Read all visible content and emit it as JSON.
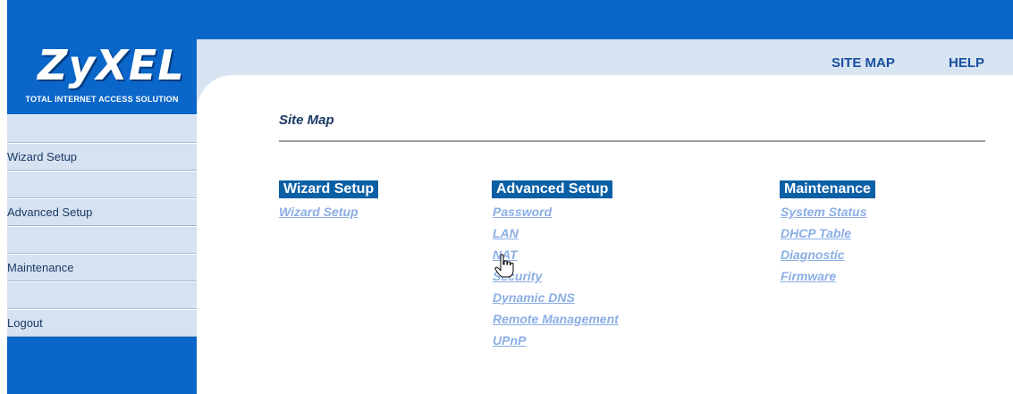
{
  "brand": {
    "logo": "ZyXEL",
    "tagline": "TOTAL INTERNET ACCESS SOLUTION"
  },
  "header": {
    "site_map": "SITE MAP",
    "help": "HELP"
  },
  "sidebar": {
    "items": [
      {
        "label": "Wizard Setup"
      },
      {
        "label": "Advanced Setup"
      },
      {
        "label": "Maintenance"
      },
      {
        "label": "Logout"
      }
    ]
  },
  "main": {
    "title": "Site Map",
    "columns": [
      {
        "heading": "Wizard Setup",
        "links": [
          "Wizard Setup"
        ]
      },
      {
        "heading": "Advanced Setup",
        "links": [
          "Password",
          "LAN",
          "NAT",
          "Security",
          "Dynamic DNS",
          "Remote Management",
          "UPnP"
        ]
      },
      {
        "heading": "Maintenance",
        "links": [
          "System Status",
          "DHCP Table",
          "Diagnostic",
          "Firmware"
        ]
      }
    ]
  },
  "colors": {
    "brand_blue": "#0a66c8",
    "heading_blue": "#0b5fa5",
    "link_color": "#8aaee6",
    "panel_light": "#d7e4f2"
  },
  "icons": {
    "cursor": "hand-pointer-cursor"
  }
}
